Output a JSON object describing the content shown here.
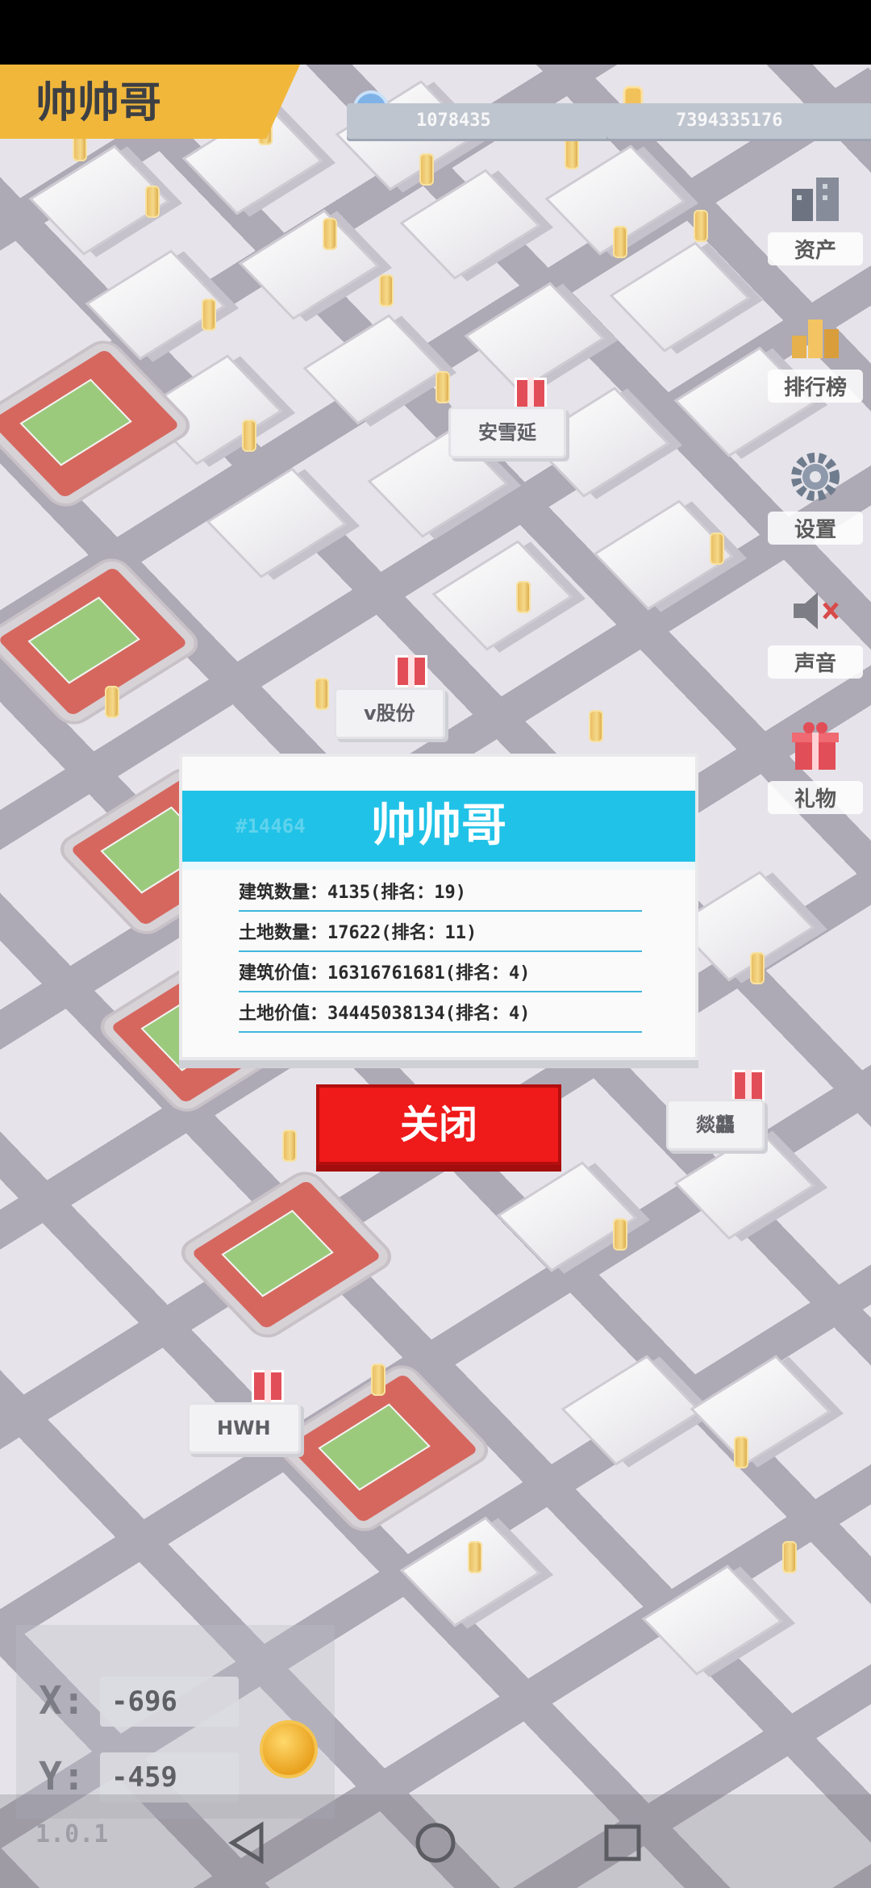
{
  "player": {
    "name": "帅帅哥"
  },
  "resources": {
    "diamond_icon": "diamond-icon",
    "diamond_value": "1078435",
    "coin_icon": "coin-icon",
    "coin_value": "7394335176"
  },
  "side_menu": [
    {
      "id": "assets",
      "label": "资产",
      "icon": "buildings-icon"
    },
    {
      "id": "ranking",
      "label": "排行榜",
      "icon": "leaderboard-icon"
    },
    {
      "id": "settings",
      "label": "设置",
      "icon": "gear-icon"
    },
    {
      "id": "sound",
      "label": "声音",
      "icon": "speaker-muted-icon"
    },
    {
      "id": "gift",
      "label": "礼物",
      "icon": "gift-icon"
    }
  ],
  "map_labels": [
    {
      "text": "安雪延"
    },
    {
      "text": "v股份"
    },
    {
      "text": "燚龘"
    },
    {
      "text": "HWH"
    }
  ],
  "dialog": {
    "id_text": "#14464",
    "title": "帅帅哥",
    "stats": [
      {
        "label": "建筑数量：4135(排名：19)"
      },
      {
        "label": "土地数量：17622(排名：11)"
      },
      {
        "label": "建筑价值：16316761681(排名：4)"
      },
      {
        "label": "土地价值：34445038134(排名：4)"
      }
    ],
    "close_label": "关闭"
  },
  "coords": {
    "x_label": "X:",
    "x_value": "-696",
    "y_label": "Y:",
    "y_value": "-459"
  },
  "version": "1.0.1",
  "colors": {
    "banner": "#f1b73b",
    "dialog_header": "#21c2e7",
    "close_button": "#ef1a1a"
  }
}
